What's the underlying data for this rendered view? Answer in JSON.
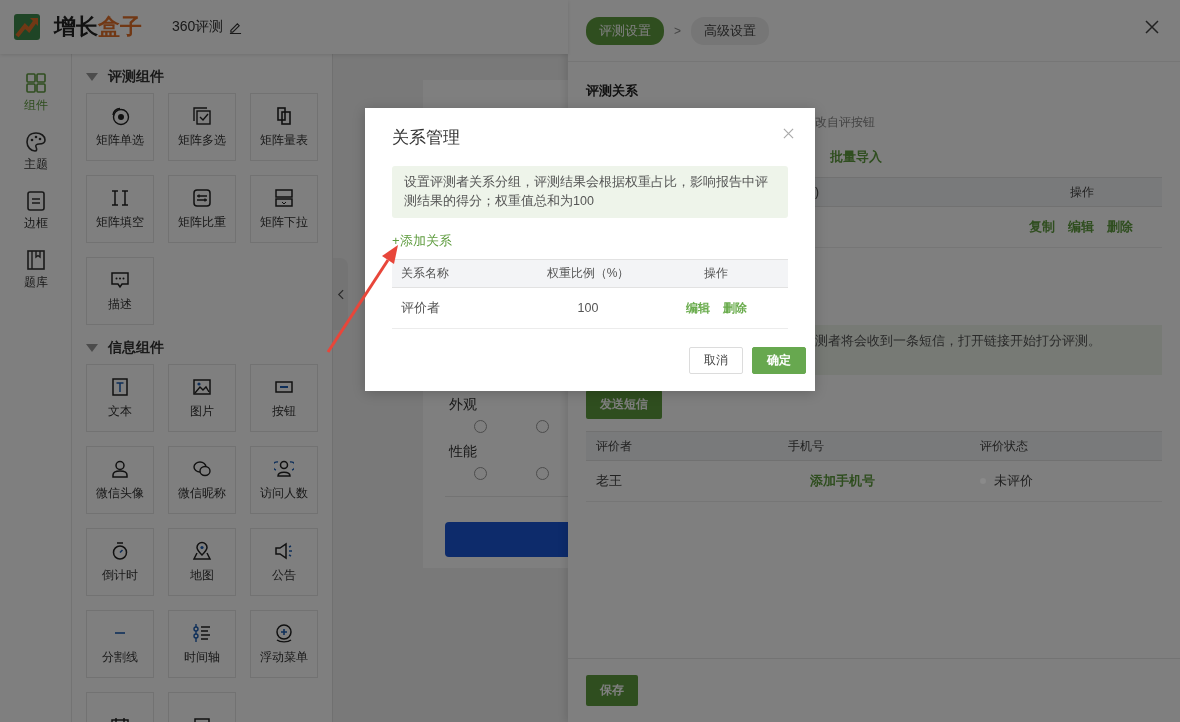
{
  "header": {
    "logo_text": "增长",
    "logo_accent": "盒子",
    "title": "360评测"
  },
  "rail": [
    {
      "label": "组件",
      "selected": true
    },
    {
      "label": "主题",
      "selected": false
    },
    {
      "label": "边框",
      "selected": false
    },
    {
      "label": "题库",
      "selected": false
    }
  ],
  "component_groups": [
    {
      "title": "评测组件",
      "expanded": true,
      "items": [
        {
          "label": "矩阵单选"
        },
        {
          "label": "矩阵多选"
        },
        {
          "label": "矩阵量表"
        },
        {
          "label": "矩阵填空"
        },
        {
          "label": "矩阵比重"
        },
        {
          "label": "矩阵下拉"
        },
        {
          "label": "描述"
        }
      ]
    },
    {
      "title": "信息组件",
      "expanded": true,
      "items": [
        {
          "label": "文本"
        },
        {
          "label": "图片"
        },
        {
          "label": "按钮"
        },
        {
          "label": "微信头像"
        },
        {
          "label": "微信昵称"
        },
        {
          "label": "访问人数"
        },
        {
          "label": "倒计时"
        },
        {
          "label": "地图"
        },
        {
          "label": "公告"
        },
        {
          "label": "分割线"
        },
        {
          "label": "时间轴"
        },
        {
          "label": "浮动菜单"
        },
        {
          "kind": "partial"
        },
        {
          "kind": "partial"
        }
      ]
    }
  ],
  "canvas": {
    "questions": [
      {
        "label": "外观",
        "options": [
          {
            "selected": false
          },
          {
            "selected": false
          }
        ]
      },
      {
        "label": "性能",
        "options": [
          {
            "selected": false
          },
          {
            "selected": false
          }
        ]
      }
    ]
  },
  "drawer": {
    "steps": [
      {
        "label": "评测设置",
        "selected": true
      },
      {
        "label": "高级设置",
        "selected": false
      }
    ],
    "separator": ">",
    "section_title": "评测关系",
    "hint": "改自评按钮",
    "import_link": "批量导入",
    "relation_table": {
      "columns": [
        ")",
        "操作"
      ],
      "rows": [
        {
          "actions": [
            "复制",
            "编辑",
            "删除"
          ]
        }
      ]
    },
    "notice": "测者将会收到一条短信，打开链接开始打分评测。",
    "send_button": "发送短信",
    "evaluator_table": {
      "columns": [
        "评价者",
        "手机号",
        "评价状态"
      ],
      "rows": [
        {
          "name": "老王",
          "phone_link": "添加手机号",
          "status": "未评价",
          "color": "#8a8a8a"
        }
      ]
    },
    "save_button": "保存"
  },
  "dialog": {
    "title": "关系管理",
    "info": "设置评测者关系分组，评测结果会根据权重占比，影响报告中评测结果的得分；权重值总和为100",
    "add_link": "+添加关系",
    "columns": [
      "关系名称",
      "权重比例（%）",
      "操作"
    ],
    "rows": [
      {
        "name": "评价者",
        "weight": "100",
        "actions": [
          "编辑",
          "删除"
        ]
      }
    ],
    "buttons": [
      {
        "label": "取消",
        "kind": "secondary"
      },
      {
        "label": "确定",
        "kind": "primary"
      }
    ]
  }
}
